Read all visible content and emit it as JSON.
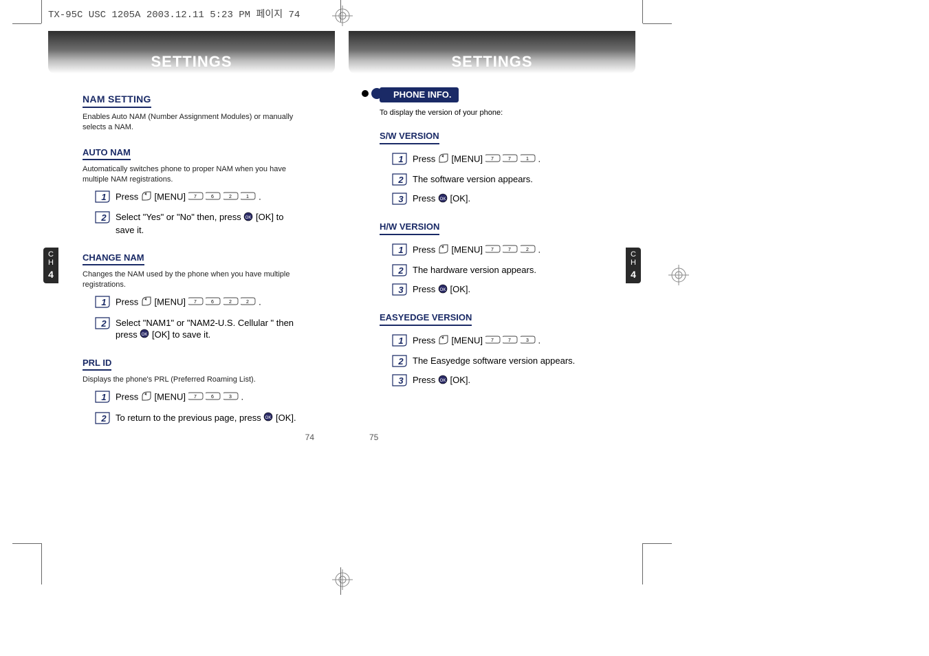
{
  "file_header": "TX-95C USC 1205A  2003.12.11 5:23 PM  페이지 74",
  "chapter_tab": {
    "chapter": "C\nH",
    "num": "4"
  },
  "left": {
    "title": "SETTINGS",
    "page_num": "74",
    "nam_setting": {
      "heading": "NAM SETTING",
      "desc": "Enables Auto NAM (Number Assignment Modules) or manually selects a NAM."
    },
    "auto_nam": {
      "heading": "AUTO NAM",
      "desc": "Automatically switches phone to proper NAM when you have multiple NAM registrations.",
      "step1_a": "Press ",
      "step1_b": " [MENU] ",
      "step1_keys": "7 6 2 1",
      "step1_c": " .",
      "step2_a": "Select \"Yes\" or \"No\" then, press ",
      "step2_b": " [OK] to save it."
    },
    "change_nam": {
      "heading": "CHANGE NAM",
      "desc": "Changes the NAM used by the phone when you have multiple registrations.",
      "step1_a": "Press ",
      "step1_b": " [MENU] ",
      "step1_keys": "7 6 2 2",
      "step1_c": " .",
      "step2_a": "Select \"NAM1\" or \"NAM2-U.S. Cellular \" then press ",
      "step2_b": " [OK] to save it."
    },
    "prl": {
      "heading": "PRL ID",
      "desc": "Displays the phone's PRL (Preferred Roaming List).",
      "step1_a": "Press ",
      "step1_b": " [MENU] ",
      "step1_keys": "7 6 3",
      "step1_c": " .",
      "step2_a": "To return to the previous page, press ",
      "step2_b": " [OK]."
    }
  },
  "right": {
    "title": "SETTINGS",
    "page_num": "75",
    "phone_info": {
      "pill": "PHONE INFO.",
      "desc": "To display the version of your phone:"
    },
    "sw": {
      "heading": "S/W VERSION",
      "step1_a": "Press ",
      "step1_b": " [MENU] ",
      "step1_keys": "7 7 1",
      "step1_c": " .",
      "step2": "The software version appears.",
      "step3_a": "Press ",
      "step3_b": " [OK]."
    },
    "hw": {
      "heading": "H/W VERSION",
      "step1_a": "Press ",
      "step1_b": " [MENU] ",
      "step1_keys": "7 7 2",
      "step1_c": ".",
      "step2": "The hardware version appears.",
      "step3_a": "Press ",
      "step3_b": " [OK]."
    },
    "ee": {
      "heading": "EASYEDGE VERSION",
      "step1_a": "Press ",
      "step1_b": " [MENU] ",
      "step1_keys": "7 7 3",
      "step1_c": ".",
      "step2": "The Easyedge software version appears.",
      "step3_a": "Press ",
      "step3_b": " [OK]."
    }
  }
}
